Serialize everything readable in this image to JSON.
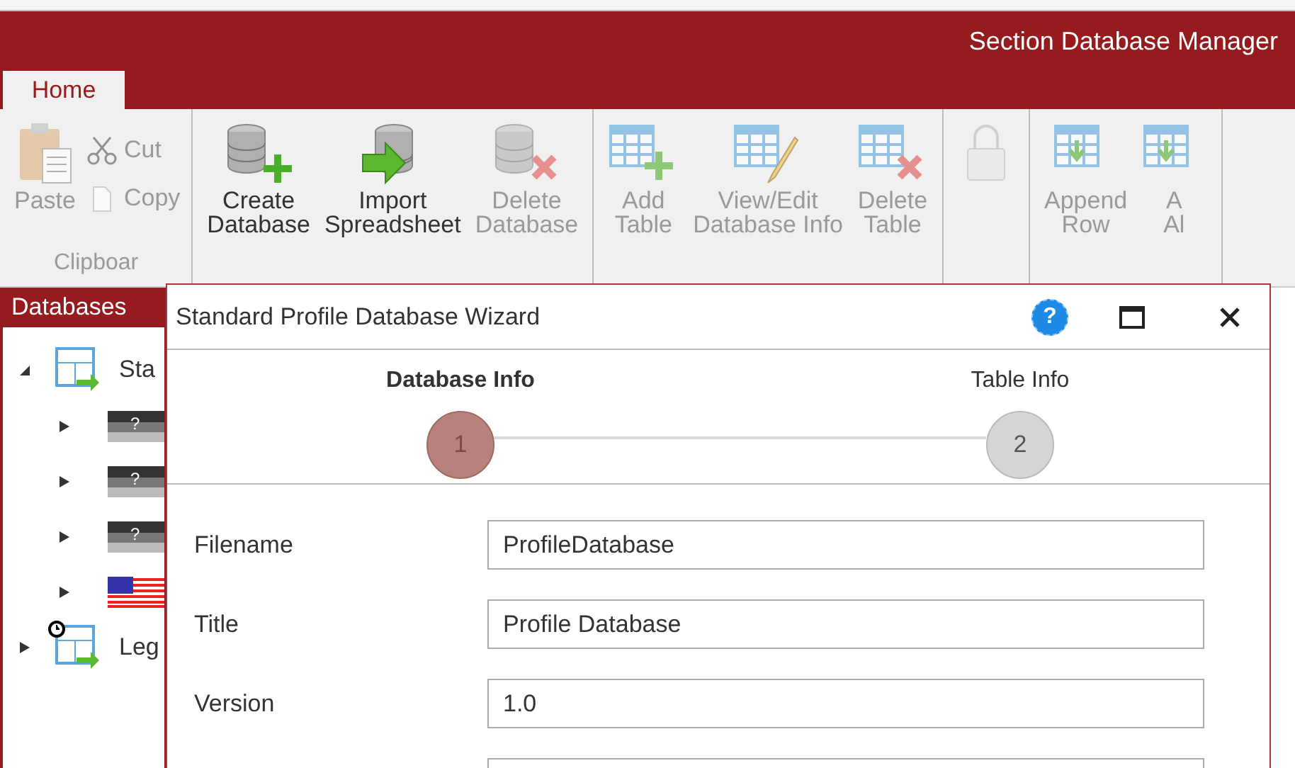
{
  "window": {
    "title": "Section Database Manager"
  },
  "tabs": [
    {
      "label": "Home",
      "selected": true
    }
  ],
  "ribbon": {
    "groups": [
      {
        "label": "Clipboar",
        "buttons": [
          {
            "label": "Paste",
            "kind": "large",
            "disabled": true
          },
          {
            "label": "Cut",
            "kind": "small",
            "disabled": true
          },
          {
            "label": "Copy",
            "kind": "small",
            "disabled": true
          }
        ]
      },
      {
        "buttons": [
          {
            "label": "Create\nDatabase",
            "kind": "large",
            "disabled": false
          },
          {
            "label": "Import\nSpreadsheet",
            "kind": "large",
            "disabled": false
          },
          {
            "label": "Delete\nDatabase",
            "kind": "large",
            "disabled": true
          }
        ]
      },
      {
        "buttons": [
          {
            "label": "Add\nTable",
            "kind": "large",
            "disabled": true
          },
          {
            "label": "View/Edit\nDatabase Info",
            "kind": "large",
            "disabled": true
          },
          {
            "label": "Delete\nTable",
            "kind": "large",
            "disabled": true
          }
        ]
      },
      {
        "buttons": [
          {
            "kind": "large",
            "disabled": true
          }
        ]
      },
      {
        "buttons": [
          {
            "label": "Append\nRow",
            "kind": "large",
            "disabled": true
          },
          {
            "label": "A\nAl",
            "kind": "large",
            "disabled": true
          }
        ]
      }
    ]
  },
  "sidebar": {
    "title": "Databases",
    "items": [
      {
        "label": "Sta",
        "kind": "database",
        "expanded": true,
        "children": [
          {
            "kind": "profile",
            "mark": "?",
            "expanded": false
          },
          {
            "kind": "profile",
            "mark": "?",
            "expanded": false
          },
          {
            "kind": "profile",
            "mark": "?",
            "expanded": false
          },
          {
            "kind": "flag",
            "expanded": false
          }
        ]
      },
      {
        "label": "Leg",
        "kind": "history",
        "expanded": false
      }
    ]
  },
  "dialog": {
    "title": "Standard Profile Database Wizard",
    "help": "?",
    "steps": [
      {
        "number": "1",
        "label": "Database Info",
        "selected": true
      },
      {
        "number": "2",
        "label": "Table Info",
        "selected": false
      }
    ],
    "fields": [
      {
        "label": "Filename",
        "value": "ProfileDatabase"
      },
      {
        "label": "Title",
        "value": "Profile Database"
      },
      {
        "label": "Version",
        "value": "1.0"
      }
    ]
  }
}
